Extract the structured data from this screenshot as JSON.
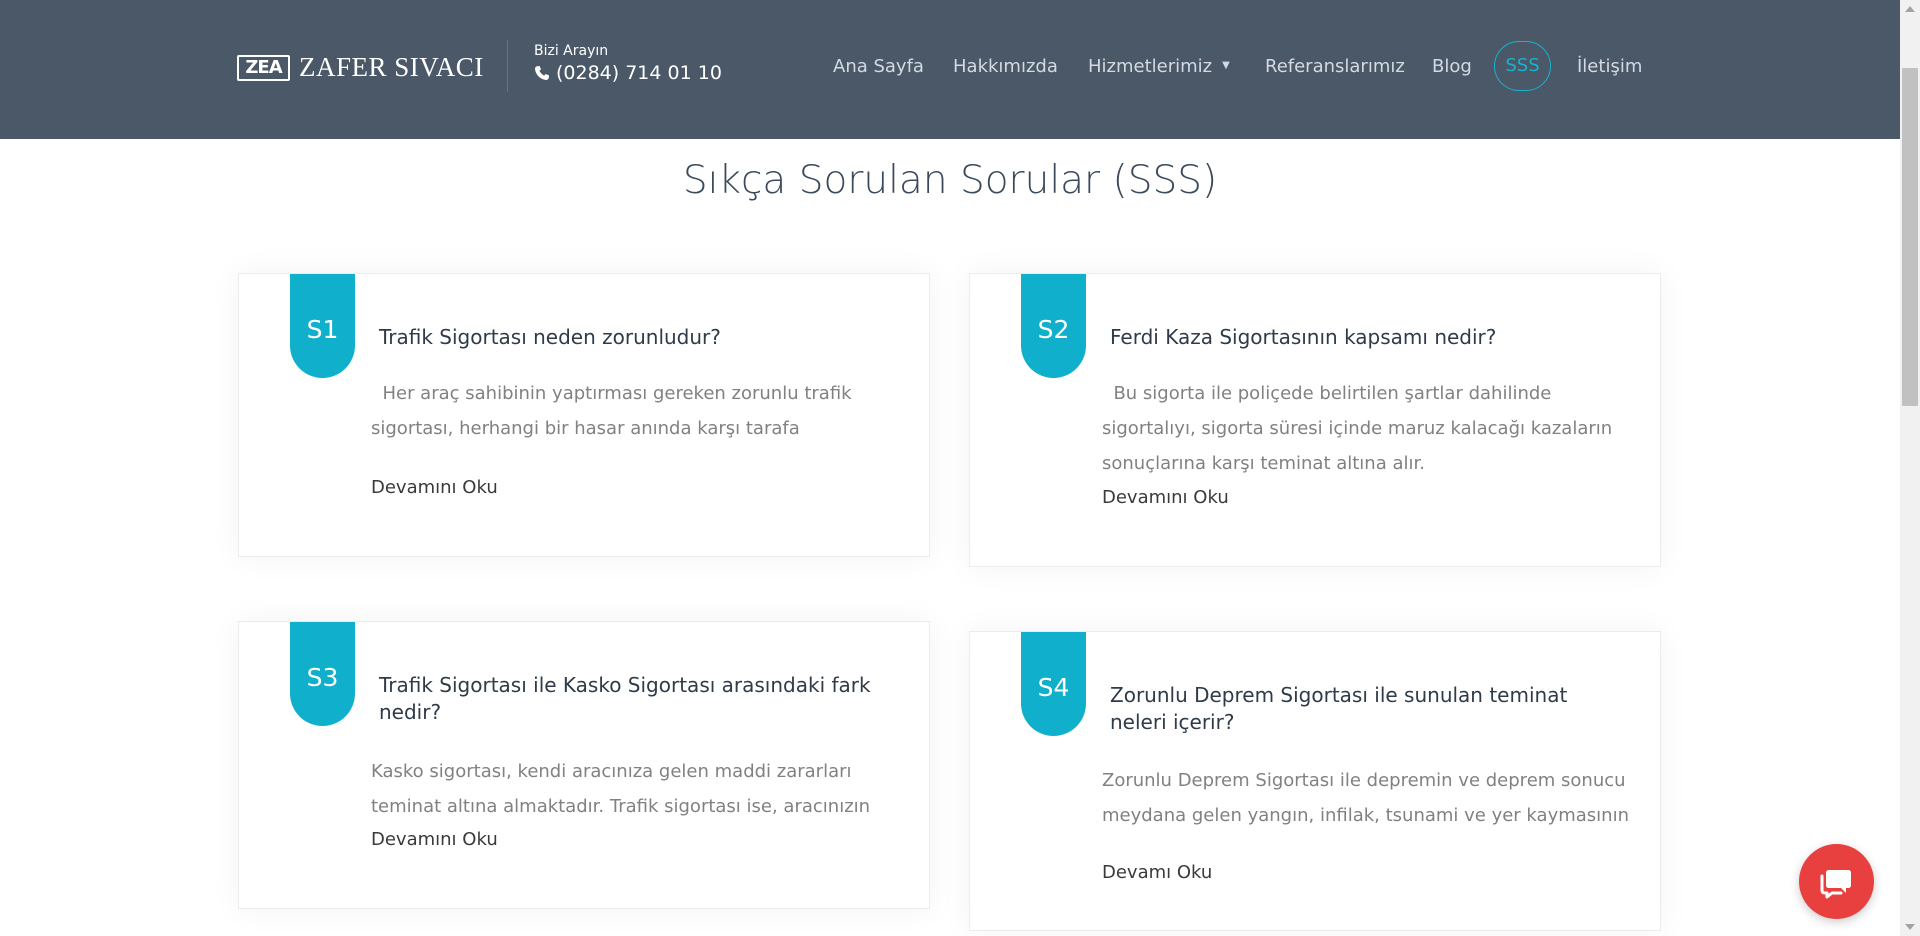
{
  "header": {
    "logo_mark": "ZEA",
    "logo_text": "ZAFER SIVACI",
    "call_label": "Bizi Arayın",
    "call_phone": "(0284) 714 01 10",
    "phone_icon": "phone-icon",
    "background": "#4a5868"
  },
  "nav": {
    "items": [
      {
        "label": "Ana Sayfa"
      },
      {
        "label": "Hakkımızda"
      },
      {
        "label": "Hizmetlerimiz",
        "caret": "▼"
      },
      {
        "label": "Referanslarımız"
      },
      {
        "label": "Blog"
      },
      {
        "label": "SSS",
        "active": true
      },
      {
        "label": "İletişim"
      }
    ],
    "active_color": "#17b3cf"
  },
  "page": {
    "title": "Sıkça Sorulan Sorular (SSS)"
  },
  "faq": [
    {
      "badge": "S1",
      "question": "Trafik Sigortası neden zorunludur?",
      "answer": "  Her araç sahibinin yaptırması gereken zorunlu trafik sigortası, herhangi bir hasar anında karşı tarafa",
      "more": "Devamını Oku"
    },
    {
      "badge": "S2",
      "question": "Ferdi Kaza Sigortasının kapsamı nedir?",
      "answer": "  Bu sigorta ile poliçede belirtilen şartlar dahilinde sigortalıyı, sigorta süresi içinde maruz kalacağı kazaların sonuçlarına karşı teminat altına alır.",
      "more": "Devamını Oku"
    },
    {
      "badge": "S3",
      "question": "Trafik Sigortası ile Kasko Sigortası arasındaki fark nedir?",
      "answer": "Kasko sigortası, kendi aracınıza gelen maddi zararları teminat altına almaktadır. Trafik sigortası ise, aracınızın",
      "more": "Devamını Oku"
    },
    {
      "badge": "S4",
      "question": "Zorunlu Deprem Sigortası ile sunulan teminat neleri içerir?",
      "answer": "Zorunlu Deprem Sigortası ile depremin ve deprem sonucu meydana gelen yangın, infilak, tsunami ve yer kaymasının",
      "more": "Devamı Oku"
    }
  ],
  "colors": {
    "accent": "#10b0cc",
    "chat_button": "#e8403f"
  },
  "chat": {
    "icon": "chat-bubble-icon"
  }
}
